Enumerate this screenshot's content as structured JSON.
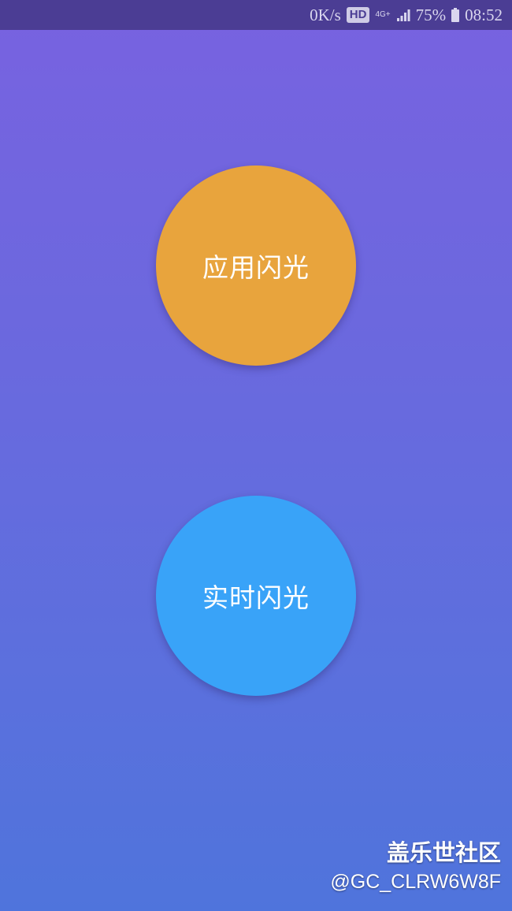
{
  "status_bar": {
    "speed": "0K/s",
    "hd": "HD",
    "network": "4G+",
    "battery": "75%",
    "time": "08:52"
  },
  "buttons": {
    "apply_flash": "应用闪光",
    "realtime_flash": "实时闪光"
  },
  "colors": {
    "apply_flash": "#e8a43d",
    "realtime_flash": "#39a3f8",
    "status_bar": "#4b3d94"
  },
  "watermark": {
    "title": "盖乐世社区",
    "user": "@GC_CLRW6W8F"
  },
  "icons": {
    "signal": "signal-icon",
    "battery": "battery-icon"
  }
}
